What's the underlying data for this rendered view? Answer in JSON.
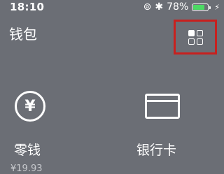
{
  "status_bar": {
    "time": "18:10",
    "lock_icon": "⊚",
    "bluetooth_icon": "✱",
    "battery_percent": "78%",
    "battery_level": 0.78,
    "charging_icon": "⚡"
  },
  "header": {
    "title": "钱包",
    "grid_icon": "grid-icon"
  },
  "tiles": [
    {
      "label": "零钱",
      "icon": "¥",
      "sub": "¥19.93"
    },
    {
      "label": "银行卡",
      "icon": "card-icon"
    }
  ],
  "colors": {
    "background": "#6b6e75",
    "highlight_border": "#c8201e",
    "battery": "#4cd964"
  }
}
